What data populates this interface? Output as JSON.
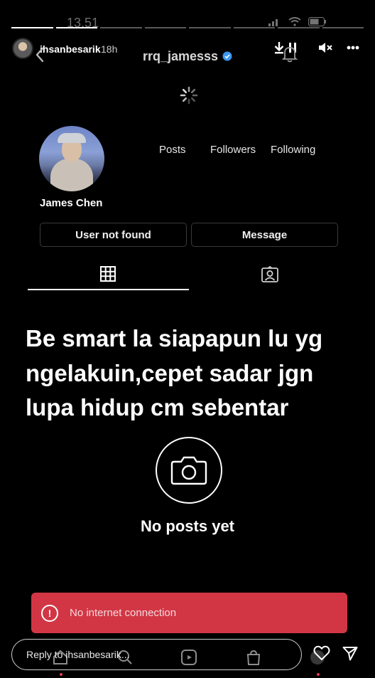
{
  "status_bar": {
    "time": "13.51"
  },
  "story": {
    "username": "ihsanbesarik",
    "time_ago": "18h",
    "reply_placeholder": "Reply to ihsanbesarik..."
  },
  "profile": {
    "handle": "rrq_jamesss",
    "full_name": "James Chen",
    "stats": {
      "posts_label": "Posts",
      "followers_label": "Followers",
      "following_label": "Following"
    },
    "buttons": {
      "primary": "User not found",
      "message": "Message"
    }
  },
  "overlay_text": "Be smart la siapapun lu yg ngelakuin,cepet sadar jgn lupa hidup cm sebentar",
  "empty_state": {
    "text": "No posts yet"
  },
  "toast": {
    "text": "No internet connection"
  },
  "icons": {
    "back": "chevron-left-icon",
    "bell": "bell-icon",
    "verified": "verified-badge-icon",
    "download": "download-icon",
    "pause": "pause-icon",
    "mute": "mute-icon",
    "more": "more-icon",
    "grid": "grid-icon",
    "tagged": "tagged-icon",
    "camera": "camera-icon",
    "error": "error-icon",
    "heart": "heart-icon",
    "send": "send-icon"
  },
  "colors": {
    "toast_bg": "#d23645",
    "verified": "#3b97f0",
    "background": "#000000"
  }
}
